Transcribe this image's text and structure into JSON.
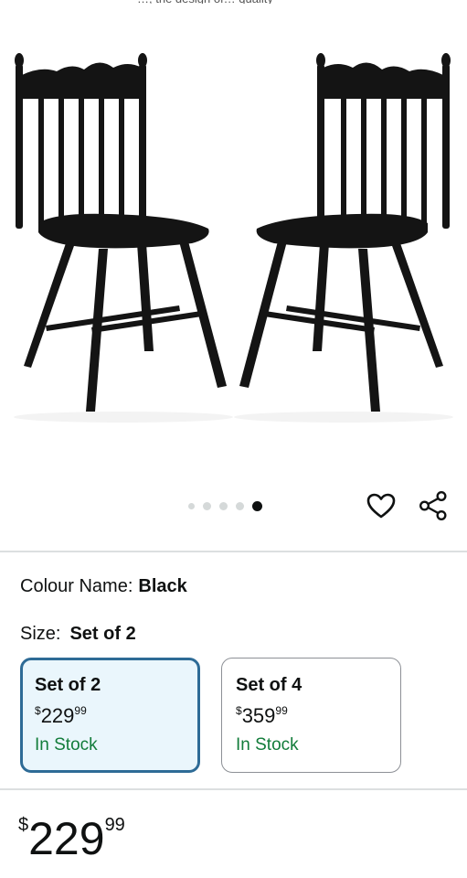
{
  "product": {
    "colour_label": "Colour Name:",
    "colour_value": "Black",
    "size_label": "Size:",
    "size_value": "Set of 2"
  },
  "gallery": {
    "image_count": 5,
    "active_index": 4,
    "icons": [
      "heart-icon",
      "share-icon"
    ]
  },
  "options": [
    {
      "name": "Set of 2",
      "currency": "$",
      "price_whole": "229",
      "price_fraction": "99",
      "stock": "In Stock",
      "selected": true
    },
    {
      "name": "Set of 4",
      "currency": "$",
      "price_whole": "359",
      "price_fraction": "99",
      "stock": "In Stock",
      "selected": false
    }
  ],
  "price": {
    "currency": "$",
    "whole": "229",
    "fraction": "99"
  },
  "colors": {
    "selected_border": "#2e6b96",
    "selected_bg": "#eaf6fc",
    "in_stock": "#127c3a",
    "divider": "#dcdfe0"
  }
}
